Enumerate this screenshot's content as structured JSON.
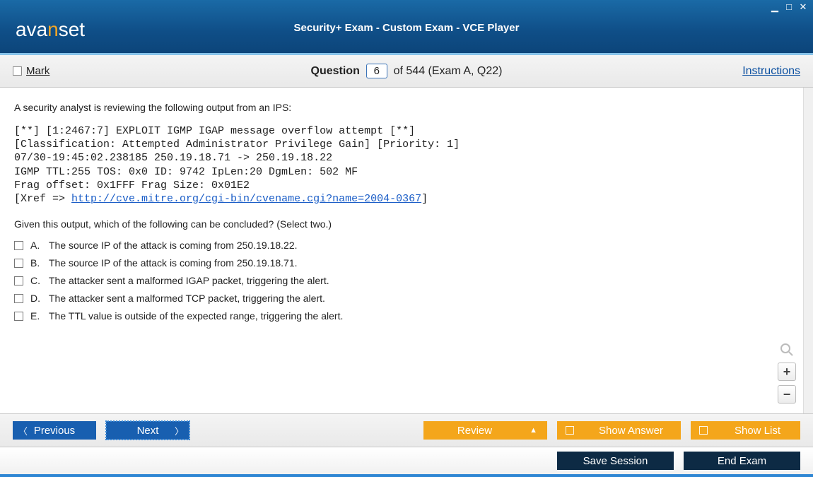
{
  "titlebar": {
    "logo": {
      "pre": "ava",
      "n": "n",
      "post": "set"
    },
    "title": "Security+ Exam - Custom Exam - VCE Player",
    "controls": {
      "min": "_",
      "max": "□",
      "close": "✕"
    }
  },
  "infobar": {
    "mark_label": "Mark",
    "question_word": "Question",
    "question_number": "6",
    "question_suffix": "of 544 (Exam A, Q22)",
    "instructions": "Instructions"
  },
  "question": {
    "prompt": "A security analyst is reviewing the following output from an IPS:",
    "code": {
      "line1": "[**] [1:2467:7] EXPLOIT IGMP IGAP message overflow attempt [**]",
      "line2": "[Classification: Attempted Administrator Privilege Gain] [Priority: 1]",
      "line3": "07/30-19:45:02.238185 250.19.18.71 -> 250.19.18.22",
      "line4": "IGMP TTL:255 TOS: 0x0 ID: 9742 IpLen:20 DgmLen: 502 MF",
      "line5": "Frag offset: 0x1FFF Frag Size: 0x01E2",
      "xref_pre": "[Xref => ",
      "xref_link": "http://cve.mitre.org/cgi-bin/cvename.cgi?name=2004-0367",
      "xref_post": "]"
    },
    "followup": "Given this output, which of the following can be concluded? (Select two.)",
    "answers": [
      {
        "letter": "A.",
        "text": "The source IP of the attack is coming from 250.19.18.22."
      },
      {
        "letter": "B.",
        "text": "The source IP of the attack is coming from 250.19.18.71."
      },
      {
        "letter": "C.",
        "text": "The attacker sent a malformed IGAP packet, triggering the alert."
      },
      {
        "letter": "D.",
        "text": "The attacker sent a malformed TCP packet, triggering the alert."
      },
      {
        "letter": "E.",
        "text": "The TTL value is outside of the expected range, triggering the alert."
      }
    ]
  },
  "zoom": {
    "plus": "+",
    "minus": "−"
  },
  "navbar": {
    "previous": "Previous",
    "next": "Next",
    "review": "Review",
    "show_answer": "Show Answer",
    "show_list": "Show List"
  },
  "sessionbar": {
    "save_session": "Save Session",
    "end_exam": "End Exam"
  }
}
